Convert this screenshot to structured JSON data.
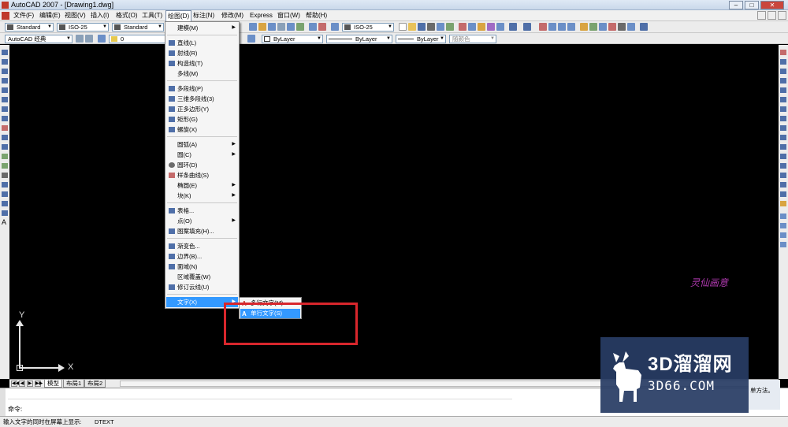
{
  "window": {
    "title": "AutoCAD 2007 - [Drawing1.dwg]",
    "min": "–",
    "max": "□",
    "close": "✕"
  },
  "menubar": {
    "items": [
      "文件(F)",
      "编辑(E)",
      "视图(V)",
      "插入(I)",
      "格式(O)",
      "工具(T)",
      "绘图(D)",
      "标注(N)",
      "修改(M)",
      "Express",
      "窗口(W)",
      "帮助(H)"
    ],
    "active": "绘图(D)"
  },
  "toolbar1": {
    "text_style": "Standard",
    "dim_style": "ISO-25",
    "table_style": "Standard",
    "dim_style2": "ISO-25"
  },
  "toolbar2": {
    "workspace": "AutoCAD 经典",
    "layer": "0",
    "color": "ByLayer",
    "linetype": "ByLayer",
    "lineweight": "ByLayer",
    "plotstyle": "随颜色"
  },
  "draw_menu": {
    "items": [
      {
        "label": "建模(M)",
        "submenu": true,
        "icon": ""
      },
      {
        "label": "直线(L)",
        "icon": "line-icon"
      },
      {
        "label": "射线(R)",
        "icon": "ray-icon"
      },
      {
        "label": "构造线(T)",
        "icon": "xline-icon"
      },
      {
        "label": "多线(M)",
        "icon": ""
      },
      {
        "label": "多段线(P)",
        "icon": "pline-icon"
      },
      {
        "label": "三维多段线(3)",
        "icon": "3dpoly-icon"
      },
      {
        "label": "正多边形(Y)",
        "icon": "polygon-icon"
      },
      {
        "label": "矩形(G)",
        "icon": "rectangle-icon"
      },
      {
        "label": "螺旋(X)",
        "icon": "helix-icon"
      },
      {
        "label": "圆弧(A)",
        "submenu": true,
        "icon": ""
      },
      {
        "label": "圆(C)",
        "submenu": true,
        "icon": ""
      },
      {
        "label": "圆环(D)",
        "icon": "donut-icon"
      },
      {
        "label": "样条曲线(S)",
        "icon": "spline-icon"
      },
      {
        "label": "椭圆(E)",
        "submenu": true,
        "icon": ""
      },
      {
        "label": "块(K)",
        "submenu": true,
        "icon": ""
      },
      {
        "label": "表格...",
        "icon": "table-icon"
      },
      {
        "label": "点(O)",
        "submenu": true,
        "icon": ""
      },
      {
        "label": "图案填充(H)...",
        "icon": "hatch-icon"
      },
      {
        "label": "渐变色...",
        "icon": "gradient-icon"
      },
      {
        "label": "边界(B)...",
        "icon": "boundary-icon"
      },
      {
        "label": "面域(N)",
        "icon": "region-icon"
      },
      {
        "label": "区域覆盖(W)",
        "icon": ""
      },
      {
        "label": "修订云线(U)",
        "icon": "revcloud-icon"
      },
      {
        "label": "文字(X)",
        "submenu": true,
        "icon": "",
        "highlighted": true
      }
    ]
  },
  "text_submenu": {
    "items": [
      {
        "label": "多行文字(M)...",
        "icon": "A"
      },
      {
        "label": "单行文字(S)",
        "icon": "A",
        "highlighted": true
      }
    ]
  },
  "ucs": {
    "x_label": "X",
    "y_label": "Y"
  },
  "layout_tabs": {
    "nav": [
      "◀◀",
      "◀",
      "▶",
      "▶▶"
    ],
    "tabs": [
      "模型",
      "布局1",
      "布局2"
    ],
    "active": "模型"
  },
  "command": {
    "prompt": "命令:"
  },
  "status": {
    "message": "输入文字的同时在屏幕上显示:",
    "command": "DTEXT"
  },
  "signature_text": "灵仙画意",
  "watermark": {
    "brand_cn": "3D溜溜网",
    "brand_en": "3D66.COM",
    "ext_text": "单方法。"
  },
  "colors": {
    "menu_highlight": "#3399ff",
    "annotation_box": "#d8262c",
    "canvas": "#000000"
  }
}
